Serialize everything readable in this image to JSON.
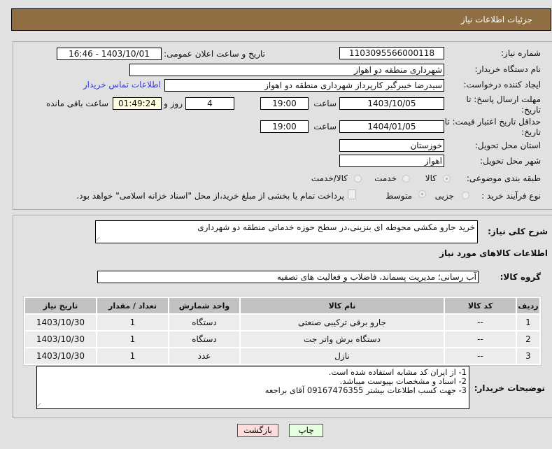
{
  "header": {
    "title": "جزئیات اطلاعات نیاز"
  },
  "form": {
    "need_number_label": "شماره نیاز:",
    "need_number": "1103095566000118",
    "announce_label": "تاریخ و ساعت اعلان عمومی:",
    "announce_value": "1403/10/01 - 16:46",
    "buyer_label": "نام دستگاه خریدار:",
    "buyer_value": "شهرداری منطقه دو اهواز",
    "creator_label": "ایجاد کننده درخواست:",
    "creator_value": "سیدرضا خیبرگیر کارپرداز  شهرداری منطقه دو اهواز",
    "contact_link": "اطلاعات تماس خریدار",
    "deadline_label_1": "مهلت ارسال پاسخ: تا",
    "deadline_label_2": "تاریخ:",
    "deadline_date": "1403/10/05",
    "time_label": "ساعت",
    "deadline_time": "19:00",
    "days": "4",
    "days_label": "روز و",
    "remaining": "01:49:24",
    "remaining_label": "ساعت باقی مانده",
    "validity_label_1": "حداقل تاریخ اعتبار قیمت: تا",
    "validity_label_2": "تاریخ:",
    "validity_date": "1404/01/05",
    "validity_time": "19:00",
    "province_label": "استان محل تحویل:",
    "province": "خوزستان",
    "city_label": "شهر محل تحویل:",
    "city": "اهواز",
    "category_label": "طبقه بندی موضوعی:",
    "category_options": [
      "كالا",
      "خدمت",
      "كالا/خدمت"
    ],
    "process_label": "نوع فرآیند خرید :",
    "process_options": [
      "جزیی",
      "متوسط"
    ],
    "payment_note": "پرداخت تمام یا بخشی از مبلغ خرید،از محل \"اسناد خزانه اسلامی\" خواهد بود."
  },
  "details": {
    "summary_label": "شرح کلی نیاز:",
    "summary": "خرید جارو مکشی محوطه ای بنزینی،در سطح حوزه خدماتی منطقه دو شهرداری",
    "goods_heading": "اطلاعات کالاهای مورد نیاز",
    "group_label": "گروه کالا:",
    "group": "آب رسانی؛ مدیریت پسماند، فاضلاب و فعالیت های تصفیه",
    "table": {
      "headers": [
        "ردیف",
        "کد کالا",
        "نام کالا",
        "واحد شمارش",
        "تعداد / مقدار",
        "تاریخ نیاز"
      ],
      "rows": [
        [
          "1",
          "--",
          "جارو برقی ترکیبی صنعتی",
          "دستگاه",
          "1",
          "1403/10/30"
        ],
        [
          "2",
          "--",
          "دستگاه برش واتر جت",
          "دستگاه",
          "1",
          "1403/10/30"
        ],
        [
          "3",
          "--",
          "نازل",
          "عدد",
          "1",
          "1403/10/30"
        ]
      ]
    },
    "notes_label": "توضیحات خریدار:",
    "notes": [
      "1- از ایران کد مشابه استفاده شده است.",
      "2- اسناد و مشخصات بپیوست میباشد.",
      "3- جهت کسب اطلاعات بیشتر 09167476355 آقای براجعه"
    ]
  },
  "buttons": {
    "print": "چاپ",
    "back": "بازگشت"
  },
  "colors": {
    "header": "#8e6e42",
    "link": "#3b3bd6",
    "back_bg": "#ffdddd",
    "print_bg": "#e6ffe0"
  }
}
